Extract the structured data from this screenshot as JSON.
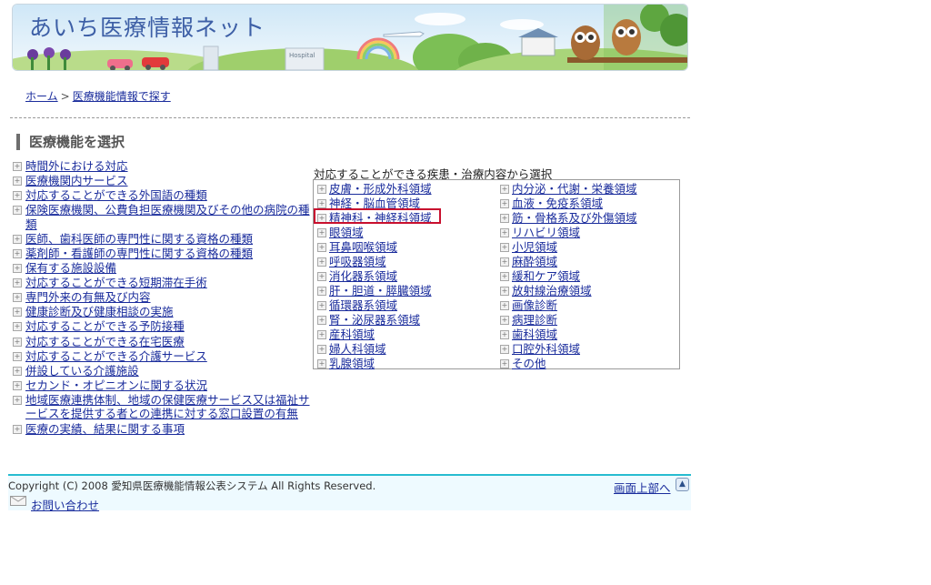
{
  "header": {
    "title": "あいち医療情報ネット",
    "hospital_sign": "Hospital"
  },
  "breadcrumb": {
    "home": "ホーム",
    "separator": ">",
    "current": "医療機能情報で探す"
  },
  "section": {
    "heading": "医療機能を選択"
  },
  "functions": [
    "時間外における対応",
    "医療機関内サービス",
    "対応することができる外国語の種類",
    "保険医療機関、公費負担医療機関及びその他の病院の種類",
    "医師、歯科医師の専門性に関する資格の種類",
    "薬剤師・看護師の専門性に関する資格の種類",
    "保有する施設設備",
    "対応することができる短期滞在手術",
    "専門外来の有無及び内容",
    "健康診断及び健康相談の実施",
    "対応することができる予防接種",
    "対応することができる在宅医療",
    "対応することができる介護サービス",
    "併設している介護施設",
    "セカンド・オピニオンに関する状況",
    "地域医療連携体制、地域の保健医療サービス又は福祉サービスを提供する者との連携に対する窓口設置の有無",
    "医療の実績、結果に関する事項"
  ],
  "areas": {
    "caption": "対応することができる疾患・治療内容から選択",
    "left": [
      "皮膚・形成外科領域",
      "神経・脳血管領域",
      "精神科・神経科領域",
      "眼領域",
      "耳鼻咽喉領域",
      "呼吸器領域",
      "消化器系領域",
      "肝・胆道・膵臓領域",
      "循環器系領域",
      "腎・泌尿器系領域",
      "産科領域",
      "婦人科領域",
      "乳腺領域"
    ],
    "right": [
      "内分泌・代謝・栄養領域",
      "血液・免疫系領域",
      "筋・骨格系及び外傷領域",
      "リハビリ領域",
      "小児領域",
      "麻酔領域",
      "緩和ケア領域",
      "放射線治療領域",
      "画像診断",
      "病理診断",
      "歯科領域",
      "口腔外科領域",
      "その他"
    ]
  },
  "footer": {
    "copyright": "Copyright (C) 2008 愛知県医療機能情報公表システム All Rights Reserved.",
    "page_top": "画面上部へ",
    "contact": "お問い合わせ"
  },
  "colors": {
    "link": "#1a2c9c",
    "highlight": "#c8102e",
    "footer_accent": "#27bcd0"
  }
}
